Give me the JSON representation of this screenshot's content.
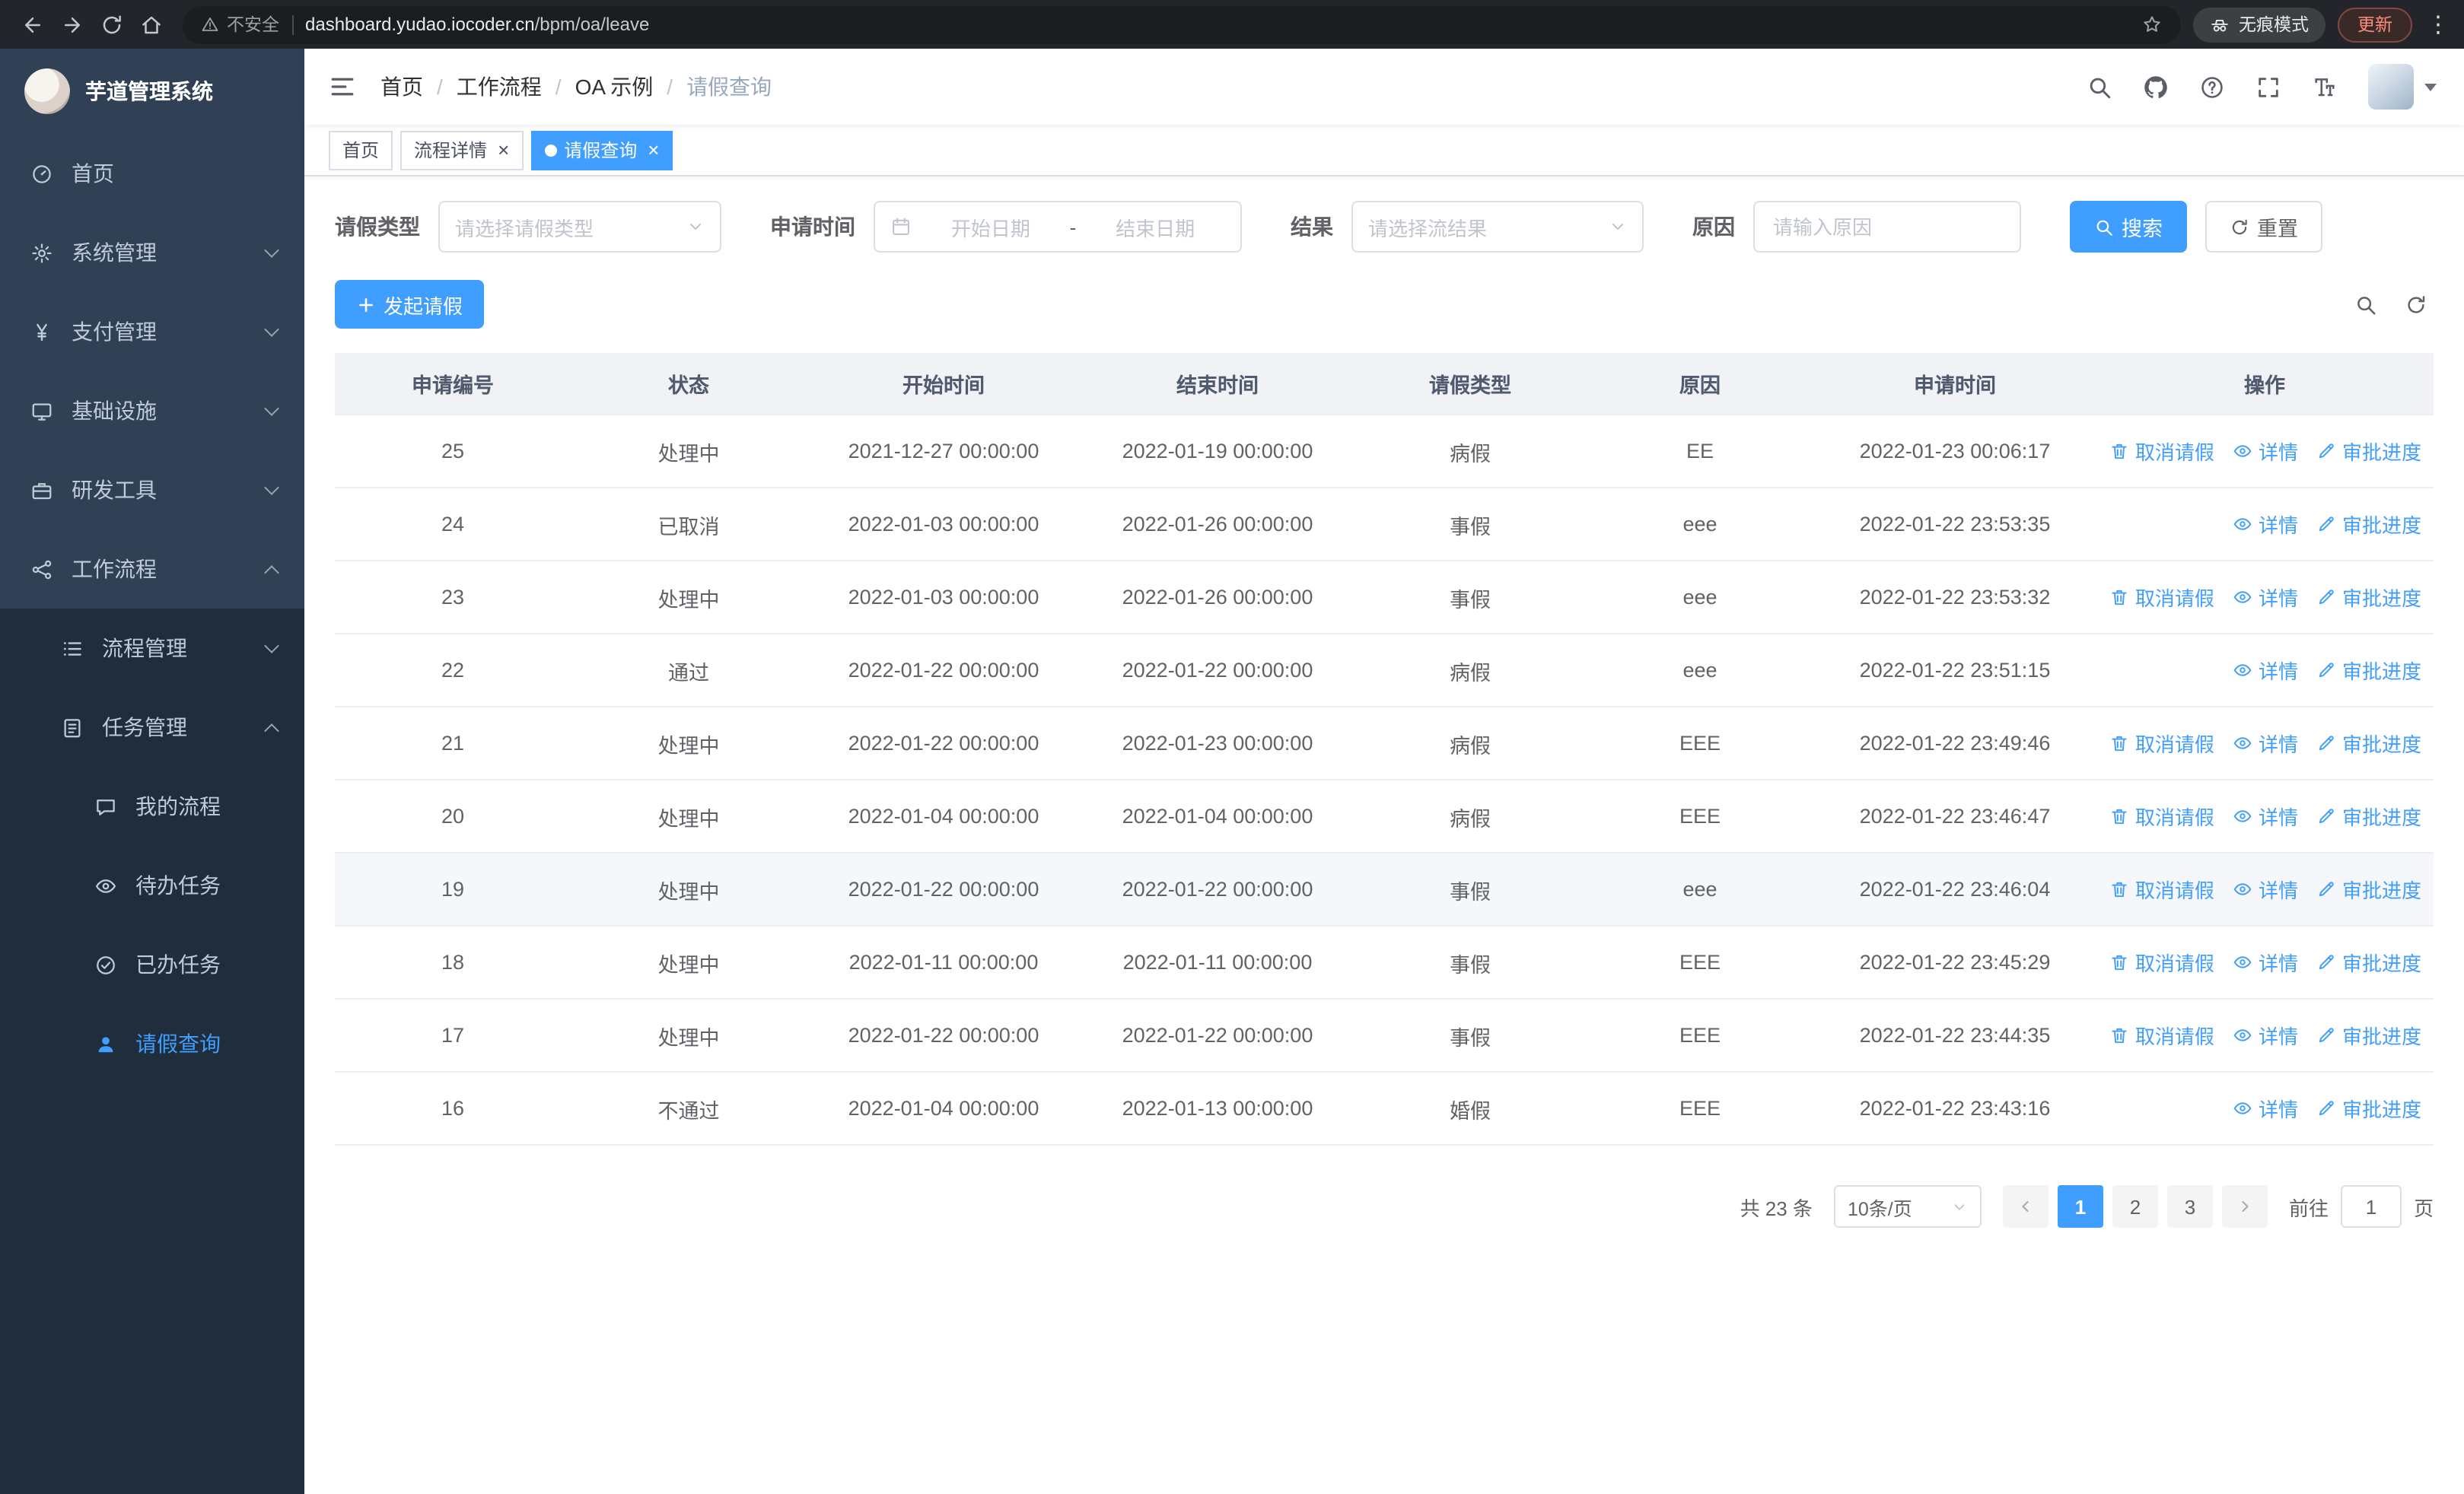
{
  "colors": {
    "accent": "#409eff",
    "sidebar_bg": "#304156",
    "submenu_bg": "#1f2d3d",
    "tab_active_bg": "#409eff",
    "link": "#409eff"
  },
  "browser": {
    "security_label": "不安全",
    "url_host": "dashboard.yudao.iocoder.cn",
    "url_path": "/bpm/oa/leave",
    "incognito_label": "无痕模式",
    "update_label": "更新"
  },
  "sidebar": {
    "logo_title": "芋道管理系统",
    "items": [
      {
        "key": "home",
        "label": "首页",
        "icon": "dashboard-icon",
        "level": 1,
        "arrow": "none",
        "active": false
      },
      {
        "key": "system",
        "label": "系统管理",
        "icon": "gear-icon",
        "level": 1,
        "arrow": "down",
        "active": false
      },
      {
        "key": "payment",
        "label": "支付管理",
        "icon": "yen-icon",
        "level": 1,
        "arrow": "down",
        "active": false
      },
      {
        "key": "infrastructure",
        "label": "基础设施",
        "icon": "monitor-icon",
        "level": 1,
        "arrow": "down",
        "active": false
      },
      {
        "key": "devtools",
        "label": "研发工具",
        "icon": "toolbox-icon",
        "level": 1,
        "arrow": "down",
        "active": false
      },
      {
        "key": "workflow",
        "label": "工作流程",
        "icon": "workflow-icon",
        "level": 1,
        "arrow": "up",
        "active": false
      },
      {
        "key": "process-management",
        "label": "流程管理",
        "icon": "list-icon",
        "level": 2,
        "arrow": "down",
        "active": false
      },
      {
        "key": "task-management",
        "label": "任务管理",
        "icon": "task-icon",
        "level": 2,
        "arrow": "up",
        "active": false
      },
      {
        "key": "my-process",
        "label": "我的流程",
        "icon": "chat-icon",
        "level": 3,
        "arrow": "none",
        "active": false
      },
      {
        "key": "todo-tasks",
        "label": "待办任务",
        "icon": "eye-icon",
        "level": 3,
        "arrow": "none",
        "active": false
      },
      {
        "key": "done-tasks",
        "label": "已办任务",
        "icon": "done-icon",
        "level": 3,
        "arrow": "none",
        "active": false
      },
      {
        "key": "leave-query",
        "label": "请假查询",
        "icon": "user-icon",
        "level": 3,
        "arrow": "none",
        "active": true
      }
    ]
  },
  "header": {
    "breadcrumb": [
      {
        "label": "首页",
        "current": false
      },
      {
        "label": "工作流程",
        "current": false
      },
      {
        "label": "OA 示例",
        "current": false
      },
      {
        "label": "请假查询",
        "current": true
      }
    ]
  },
  "tabs": [
    {
      "key": "home",
      "label": "首页",
      "closable": false,
      "active": false
    },
    {
      "key": "process-detail",
      "label": "流程详情",
      "closable": true,
      "active": false
    },
    {
      "key": "leave-query",
      "label": "请假查询",
      "closable": true,
      "active": true
    }
  ],
  "filters": {
    "type_label": "请假类型",
    "type_placeholder": "请选择请假类型",
    "time_label": "申请时间",
    "start_placeholder": "开始日期",
    "range_separator": "-",
    "end_placeholder": "结束日期",
    "result_label": "结果",
    "result_placeholder": "请选择流结果",
    "reason_label": "原因",
    "reason_placeholder": "请输入原因",
    "search_label": "搜索",
    "reset_label": "重置"
  },
  "toolbar": {
    "create_label": "发起请假"
  },
  "table": {
    "columns": [
      "申请编号",
      "状态",
      "开始时间",
      "结束时间",
      "请假类型",
      "原因",
      "申请时间",
      "操作"
    ],
    "action_labels": {
      "cancel": "取消请假",
      "detail": "详情",
      "progress": "审批进度"
    },
    "rows": [
      {
        "id": "25",
        "status": "处理中",
        "start": "2021-12-27 00:00:00",
        "end": "2022-01-19 00:00:00",
        "type": "病假",
        "reason": "EE",
        "apply_time": "2022-01-23 00:06:17",
        "actions": [
          "cancel",
          "detail",
          "progress"
        ],
        "highlighted": false
      },
      {
        "id": "24",
        "status": "已取消",
        "start": "2022-01-03 00:00:00",
        "end": "2022-01-26 00:00:00",
        "type": "事假",
        "reason": "eee",
        "apply_time": "2022-01-22 23:53:35",
        "actions": [
          "detail",
          "progress"
        ],
        "highlighted": false
      },
      {
        "id": "23",
        "status": "处理中",
        "start": "2022-01-03 00:00:00",
        "end": "2022-01-26 00:00:00",
        "type": "事假",
        "reason": "eee",
        "apply_time": "2022-01-22 23:53:32",
        "actions": [
          "cancel",
          "detail",
          "progress"
        ],
        "highlighted": false
      },
      {
        "id": "22",
        "status": "通过",
        "start": "2022-01-22 00:00:00",
        "end": "2022-01-22 00:00:00",
        "type": "病假",
        "reason": "eee",
        "apply_time": "2022-01-22 23:51:15",
        "actions": [
          "detail",
          "progress"
        ],
        "highlighted": false
      },
      {
        "id": "21",
        "status": "处理中",
        "start": "2022-01-22 00:00:00",
        "end": "2022-01-23 00:00:00",
        "type": "病假",
        "reason": "EEE",
        "apply_time": "2022-01-22 23:49:46",
        "actions": [
          "cancel",
          "detail",
          "progress"
        ],
        "highlighted": false
      },
      {
        "id": "20",
        "status": "处理中",
        "start": "2022-01-04 00:00:00",
        "end": "2022-01-04 00:00:00",
        "type": "病假",
        "reason": "EEE",
        "apply_time": "2022-01-22 23:46:47",
        "actions": [
          "cancel",
          "detail",
          "progress"
        ],
        "highlighted": false
      },
      {
        "id": "19",
        "status": "处理中",
        "start": "2022-01-22 00:00:00",
        "end": "2022-01-22 00:00:00",
        "type": "事假",
        "reason": "eee",
        "apply_time": "2022-01-22 23:46:04",
        "actions": [
          "cancel",
          "detail",
          "progress"
        ],
        "highlighted": true
      },
      {
        "id": "18",
        "status": "处理中",
        "start": "2022-01-11 00:00:00",
        "end": "2022-01-11 00:00:00",
        "type": "事假",
        "reason": "EEE",
        "apply_time": "2022-01-22 23:45:29",
        "actions": [
          "cancel",
          "detail",
          "progress"
        ],
        "highlighted": false
      },
      {
        "id": "17",
        "status": "处理中",
        "start": "2022-01-22 00:00:00",
        "end": "2022-01-22 00:00:00",
        "type": "事假",
        "reason": "EEE",
        "apply_time": "2022-01-22 23:44:35",
        "actions": [
          "cancel",
          "detail",
          "progress"
        ],
        "highlighted": false
      },
      {
        "id": "16",
        "status": "不通过",
        "start": "2022-01-04 00:00:00",
        "end": "2022-01-13 00:00:00",
        "type": "婚假",
        "reason": "EEE",
        "apply_time": "2022-01-22 23:43:16",
        "actions": [
          "detail",
          "progress"
        ],
        "highlighted": false
      }
    ]
  },
  "pagination": {
    "total_text": "共 23 条",
    "page_size_label": "10条/页",
    "pages": [
      "1",
      "2",
      "3"
    ],
    "active_page": "1",
    "goto_label": "前往",
    "goto_value": "1",
    "goto_suffix": "页"
  }
}
